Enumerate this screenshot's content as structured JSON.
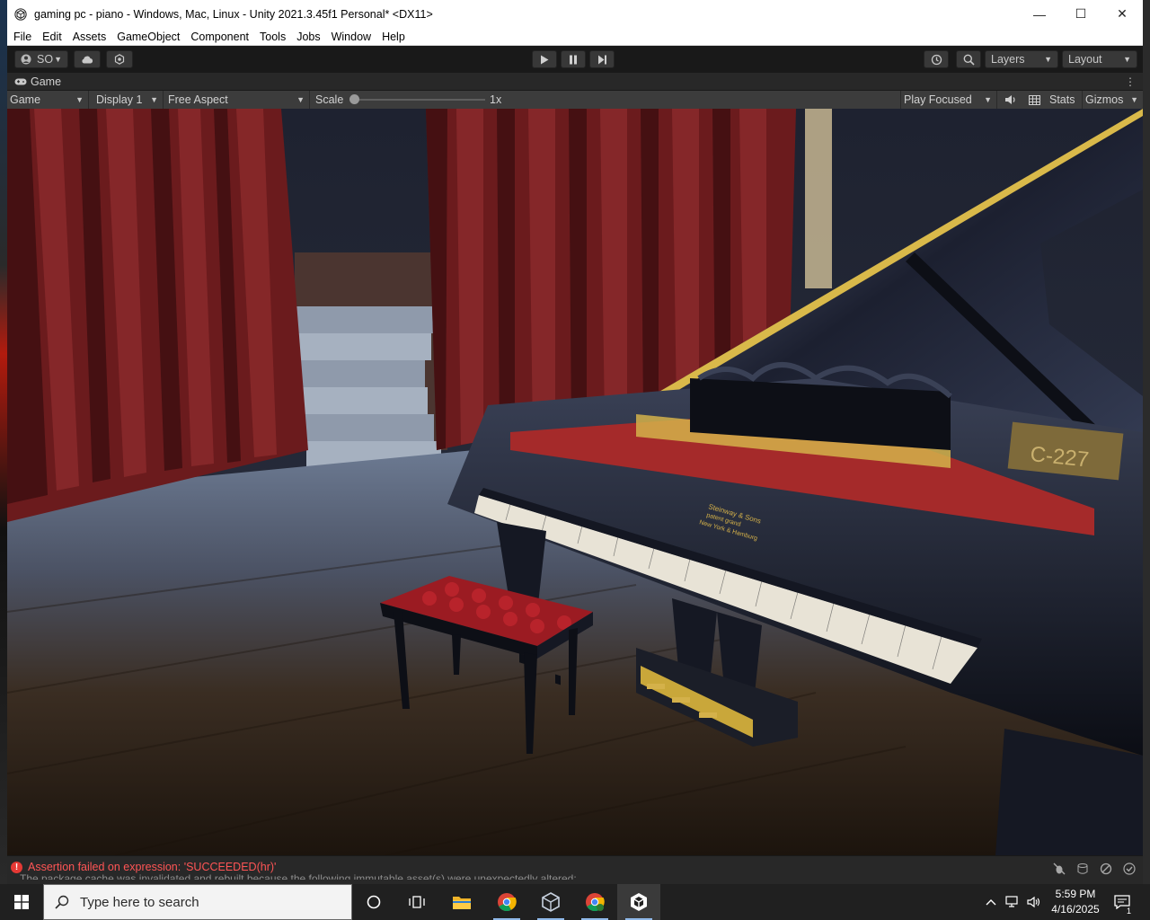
{
  "window": {
    "title": "gaming pc - piano - Windows, Mac, Linux - Unity 2021.3.45f1 Personal* <DX11>",
    "minimize": "—",
    "maximize": "☐",
    "close": "✕"
  },
  "menu": [
    "File",
    "Edit",
    "Assets",
    "GameObject",
    "Component",
    "Tools",
    "Jobs",
    "Window",
    "Help"
  ],
  "toolbar": {
    "account_label": "SO",
    "layers_label": "Layers",
    "layout_label": "Layout"
  },
  "game_tab": {
    "label": "Game"
  },
  "game_controls": {
    "view_select": "Game",
    "display_select": "Display 1",
    "aspect_select": "Free Aspect",
    "scale_label": "Scale",
    "scale_value": "1x",
    "scale_level": 0.0,
    "play_mode_select": "Play Focused",
    "stats_label": "Stats",
    "gizmos_label": "Gizmos"
  },
  "scene": {
    "placard_text": "C-227",
    "brand_lines": [
      "Steinway & Sons",
      "patent grand",
      "New York & Hamburg"
    ]
  },
  "console": {
    "error_text": "Assertion failed on expression: 'SUCCEEDED(hr)'",
    "partial_text": "The package cache was invalidated and rebuilt because the following immutable asset(s) were unexpectedly altered:"
  },
  "taskbar": {
    "search_placeholder": "Type here to search",
    "time": "5:59 PM",
    "date": "4/16/2025",
    "notification_count": "1"
  },
  "colors": {
    "unity_dark": "#191919",
    "error_red": "#ff5555",
    "curtain_red": "#7a1e20",
    "piano_black": "#0d0f16",
    "gold": "#c9a73a"
  }
}
